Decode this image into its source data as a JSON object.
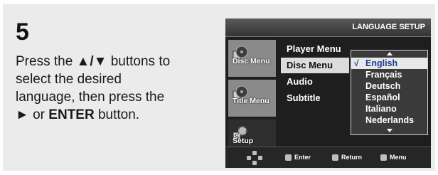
{
  "step": {
    "number": "5",
    "line1_pre": "Press the ",
    "line1_arrows": "▲/▼",
    "line1_post": " buttons to",
    "line2": "select the desired",
    "line3": "language, then press the",
    "line4_arrow": "►",
    "line4_pre": " or ",
    "line4_bold": "ENTER",
    "line4_post": " button."
  },
  "screen": {
    "title": "LANGUAGE SETUP",
    "tabs": [
      {
        "label": "Disc Menu",
        "icon": "disc-icon"
      },
      {
        "label": "Title Menu",
        "icon": "title-icon"
      },
      {
        "label": "Setup",
        "icon": "setup-icon"
      }
    ],
    "options": [
      "Player Menu",
      "Disc Menu",
      "Audio",
      "Subtitle"
    ],
    "selected_option": "Disc Menu",
    "languages": [
      "English",
      "Français",
      "Deutsch",
      "Español",
      "Italiano",
      "Nederlands"
    ],
    "current_language": "English",
    "check_mark": "√",
    "footer": {
      "enter": "Enter",
      "return": "Return",
      "menu": "Menu"
    }
  }
}
